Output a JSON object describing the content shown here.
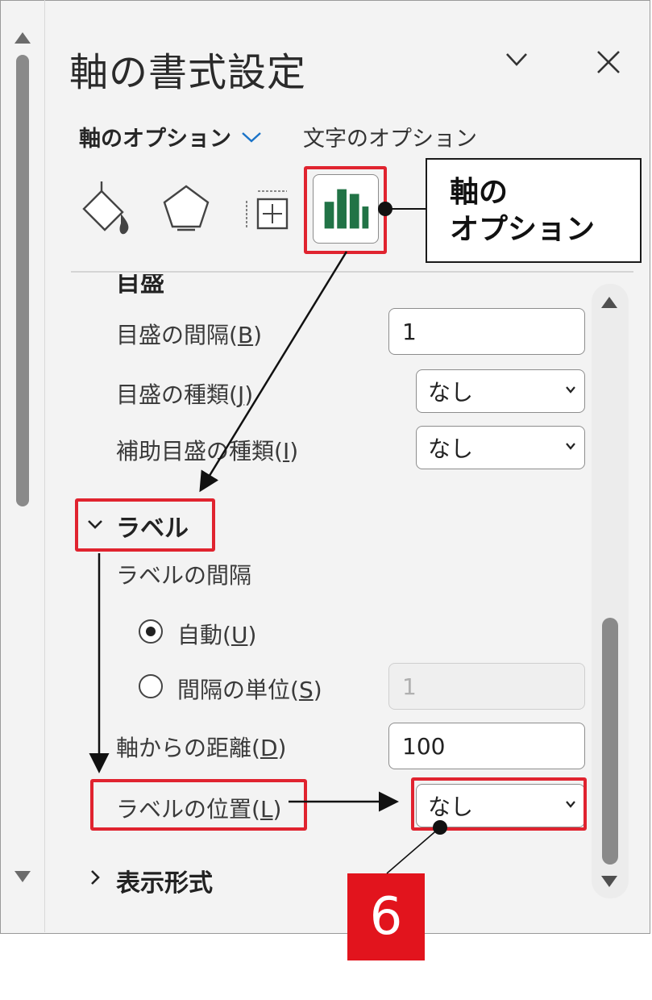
{
  "panel": {
    "title": "軸の書式設定",
    "tab_axis_options": "軸のオプション",
    "tab_text_options": "文字のオプション"
  },
  "categories": [
    "fill-line-icon",
    "effects-icon",
    "size-properties-icon",
    "axis-options-chart-icon"
  ],
  "callout": {
    "line1": "軸の",
    "line2": "オプション"
  },
  "ticks": {
    "cut_heading": "目盛",
    "interval_label": "目盛の間隔(B)",
    "interval_value": "1",
    "type_label": "目盛の種類(J)",
    "type_value": "なし",
    "minor_type_label": "補助目盛の種類(I)",
    "minor_type_value": "なし"
  },
  "labels_section": {
    "heading": "ラベル",
    "interval_heading": "ラベルの間隔",
    "auto_label": "自動(U)",
    "unit_label": "間隔の単位(S)",
    "unit_value": "1",
    "distance_label": "軸からの距離(D)",
    "distance_value": "100",
    "position_label": "ラベルの位置(L)",
    "position_value": "なし"
  },
  "number_section": {
    "heading": "表示形式"
  },
  "step_badge": "6",
  "colors": {
    "highlight": "#e0232f",
    "badge": "#e2141d",
    "chart_green": "#217346"
  }
}
